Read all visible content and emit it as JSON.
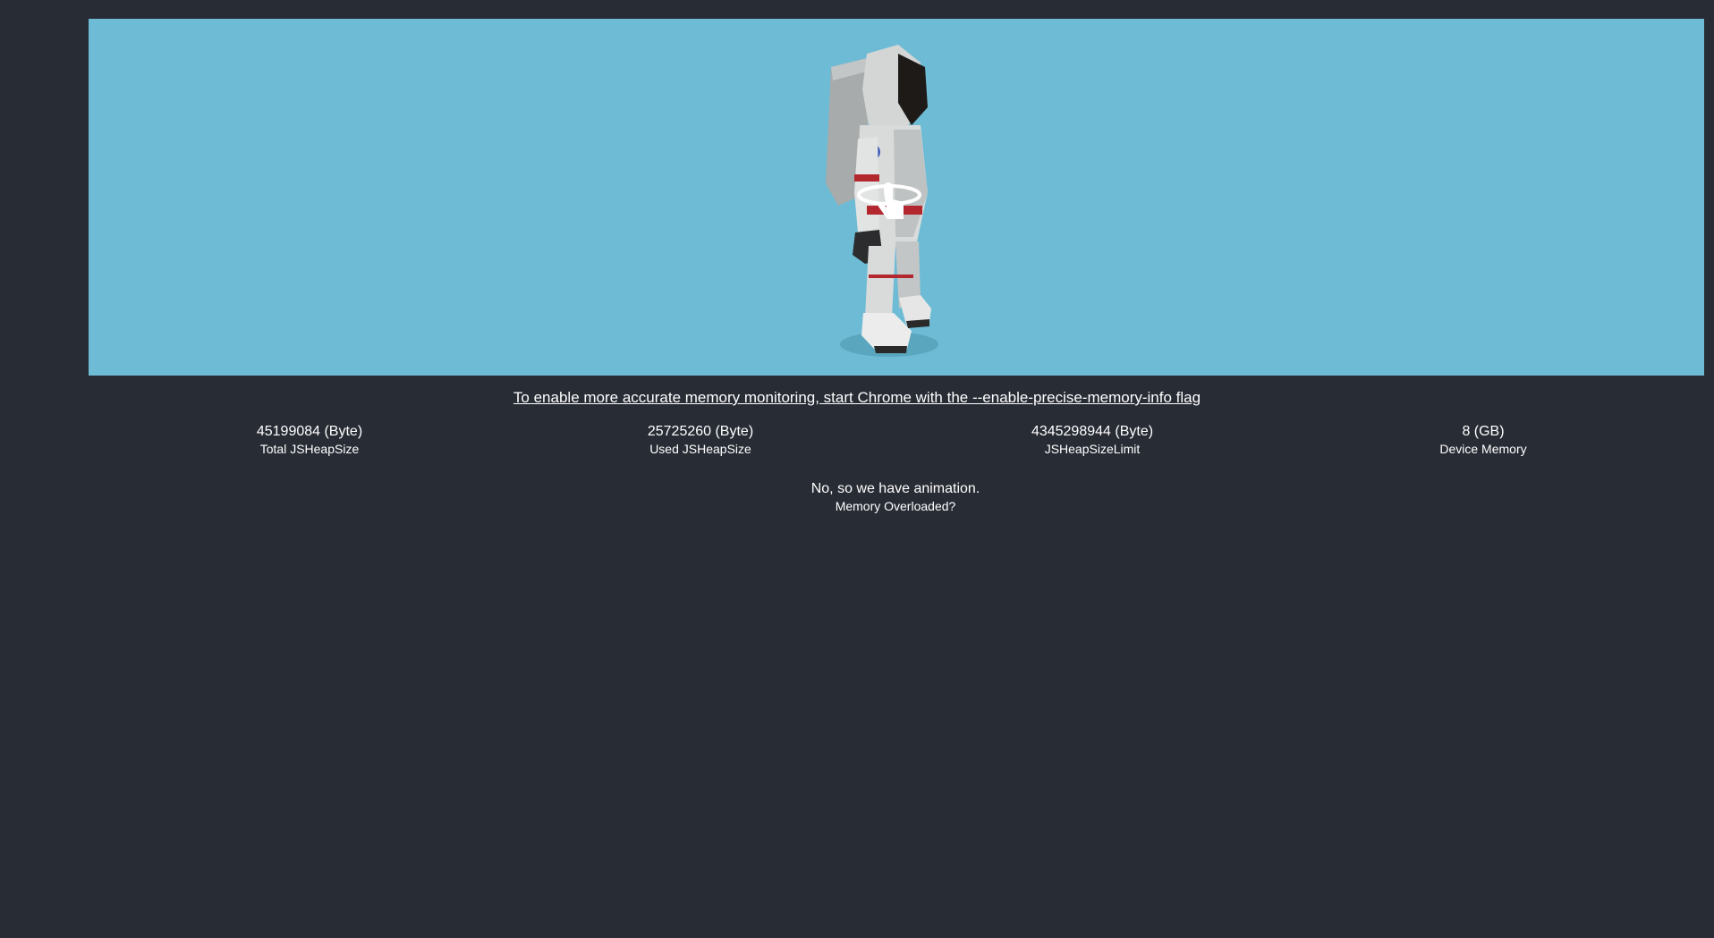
{
  "notice": {
    "link_text": "To enable more accurate memory monitoring, start Chrome with the --enable-precise-memory-info flag"
  },
  "stats": [
    {
      "value": "45199084 (Byte)",
      "label": "Total JSHeapSize"
    },
    {
      "value": "25725260 (Byte)",
      "label": "Used JSHeapSize"
    },
    {
      "value": "4345298944 (Byte)",
      "label": "JSHeapSizeLimit"
    },
    {
      "value": "8 (GB)",
      "label": "Device Memory"
    }
  ],
  "status": {
    "line1": "No, so we have animation.",
    "line2": "Memory Overloaded?"
  },
  "viewer": {
    "background": "#6dbbd4",
    "model": "astronaut-model",
    "hint_icon": "rotate-hand-icon"
  }
}
